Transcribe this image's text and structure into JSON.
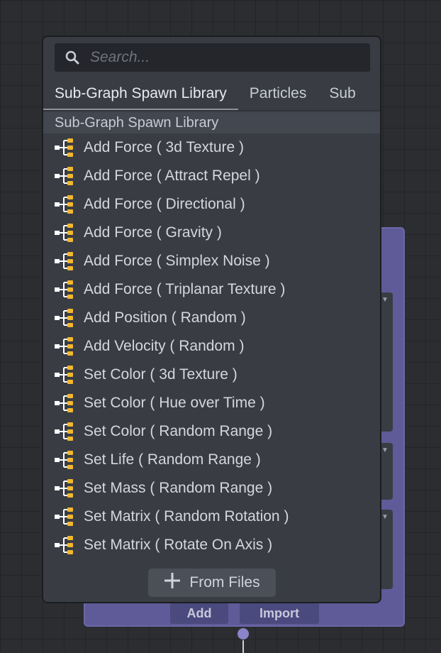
{
  "search": {
    "placeholder": "Search..."
  },
  "tabs": [
    {
      "label": "Sub-Graph Spawn Library",
      "active": true
    },
    {
      "label": "Particles",
      "active": false
    },
    {
      "label": "Sub",
      "active": false
    }
  ],
  "section": {
    "title": "Sub-Graph Spawn Library"
  },
  "items": [
    "Add Force ( 3d Texture )",
    "Add Force ( Attract Repel )",
    "Add Force ( Directional )",
    "Add Force ( Gravity )",
    "Add Force ( Simplex Noise )",
    "Add Force ( Triplanar Texture )",
    "Add Position ( Random )",
    "Add Velocity ( Random )",
    "Set Color ( 3d Texture )",
    "Set Color ( Hue over Time )",
    "Set Color ( Random Range )",
    "Set Life ( Random Range )",
    "Set Mass ( Random Range )",
    "Set Matrix ( Random Rotation )",
    "Set Matrix ( Rotate On Axis )"
  ],
  "from_files": {
    "label": "From Files",
    "icon": "plus-icon"
  },
  "background_node": {
    "add_label": "Add",
    "import_label": "Import"
  },
  "colors": {
    "subgraph_icon": "#f2b72e",
    "node_accent": "#5f5a98"
  }
}
